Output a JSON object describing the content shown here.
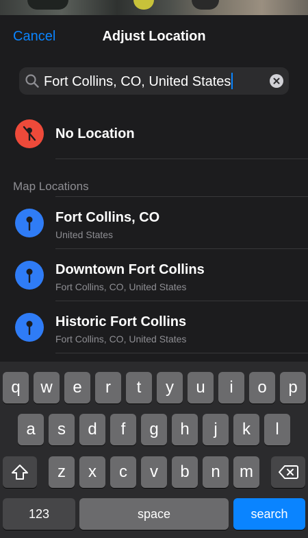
{
  "nav": {
    "cancel_label": "Cancel",
    "title": "Adjust Location"
  },
  "search": {
    "value": "Fort Collins, CO, United States",
    "icon": "magnifier-icon",
    "clear_icon": "clear-x-icon"
  },
  "no_location": {
    "label": "No Location",
    "icon": "no-location-pin-icon",
    "color": "#ee4a3a"
  },
  "section": {
    "header": "Map Locations"
  },
  "locations": [
    {
      "title": "Fort Collins, CO",
      "subtitle": "United States"
    },
    {
      "title": "Downtown Fort Collins",
      "subtitle": "Fort Collins, CO, United States"
    },
    {
      "title": "Historic Fort Collins",
      "subtitle": "Fort Collins, CO, United States"
    }
  ],
  "keyboard": {
    "row1": [
      "q",
      "w",
      "e",
      "r",
      "t",
      "y",
      "u",
      "i",
      "o",
      "p"
    ],
    "row2": [
      "a",
      "s",
      "d",
      "f",
      "g",
      "h",
      "j",
      "k",
      "l"
    ],
    "row3": [
      "z",
      "x",
      "c",
      "v",
      "b",
      "n",
      "m"
    ],
    "numbers_label": "123",
    "space_label": "space",
    "search_label": "search",
    "shift_icon": "shift-arrow-icon",
    "delete_icon": "backspace-icon"
  },
  "colors": {
    "accent": "#0a84ff",
    "location_pin": "#2f7cf6"
  }
}
